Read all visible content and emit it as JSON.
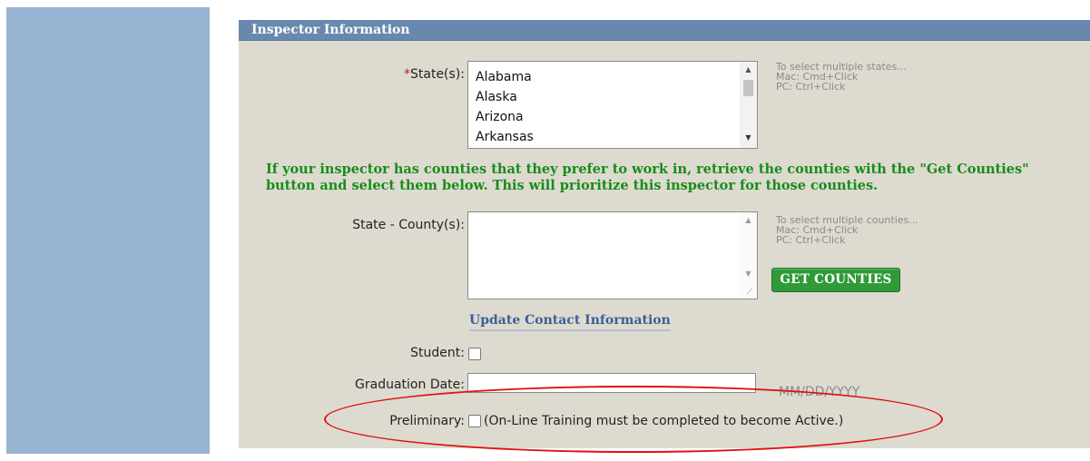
{
  "sidebar": {},
  "panel": {
    "title": "Inspector Information"
  },
  "states": {
    "required_marker": "*",
    "label": "State(s):",
    "options": [
      "Alabama",
      "Alaska",
      "Arizona",
      "Arkansas"
    ],
    "hint_title": "To select multiple states...",
    "hint_mac": "Mac: Cmd+Click",
    "hint_pc": "PC: Ctrl+Click"
  },
  "notice": "If your inspector has counties that they prefer to work in, retrieve the counties with the \"Get Counties\" button and select them below. This will prioritize this inspector for those counties.",
  "counties": {
    "label": "State - County(s):",
    "hint_title": "To select multiple counties...",
    "hint_mac": "Mac: Cmd+Click",
    "hint_pc": "PC: Ctrl+Click",
    "button_label": "GET COUNTIES"
  },
  "contact_link": "Update Contact Information",
  "student": {
    "label": "Student:",
    "checked": false
  },
  "graduation": {
    "label": "Graduation Date:",
    "value": "",
    "hint": "MM/DD/YYYY"
  },
  "preliminary": {
    "label": "Preliminary:",
    "checked": false,
    "note": "(On-Line Training must be completed to become Active.)"
  },
  "colors": {
    "header": "#6889ad",
    "panel": "#dddbd0",
    "sidebar": "#99b4d2",
    "notice": "#1a8b1a",
    "button": "#2f9a37",
    "annotation": "#e01010"
  }
}
